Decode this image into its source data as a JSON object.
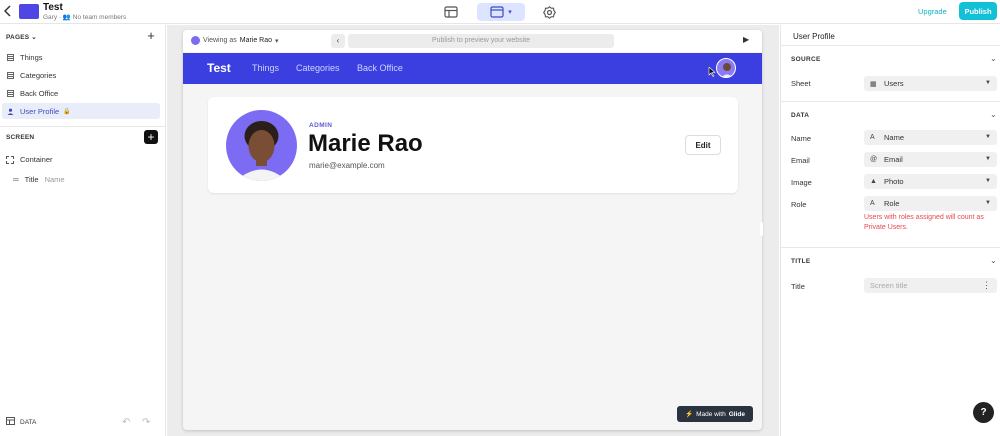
{
  "topbar": {
    "app_title": "Test",
    "app_subtitle_user": "Gary",
    "app_subtitle_team": "No team members",
    "upgrade_label": "Upgrade",
    "publish_label": "Publish"
  },
  "left": {
    "pages_heading": "PAGES",
    "pages": [
      {
        "label": "Things",
        "icon": "table-icon"
      },
      {
        "label": "Categories",
        "icon": "table-icon"
      },
      {
        "label": "Back Office",
        "icon": "table-icon"
      },
      {
        "label": "User Profile",
        "icon": "user-icon",
        "active": true,
        "locked": true
      }
    ],
    "screen_heading": "SCREEN",
    "screen_items": [
      {
        "label": "Container",
        "icon": "container-icon"
      },
      {
        "label": "Title",
        "sub": "Name",
        "icon": "title-icon"
      }
    ],
    "data_label": "DATA"
  },
  "canvas": {
    "viewing_prefix": "Viewing as",
    "viewing_user": "Marie Rao",
    "url_placeholder": "Publish to preview your website",
    "app_brand": "Test",
    "nav_links": [
      "Things",
      "Categories",
      "Back Office"
    ],
    "profile": {
      "role": "ADMIN",
      "name": "Marie Rao",
      "email": "marie@example.com",
      "edit_label": "Edit"
    },
    "made_with_prefix": "Made with",
    "made_with_brand": "Glide",
    "accent_color": "#3b3fe0"
  },
  "right": {
    "title": "User Profile",
    "source_heading": "SOURCE",
    "sheet_label": "Sheet",
    "sheet_value": "Users",
    "data_heading": "DATA",
    "fields": [
      {
        "label": "Name",
        "value": "Name",
        "icon": "text-icon"
      },
      {
        "label": "Email",
        "value": "Email",
        "icon": "at-icon"
      },
      {
        "label": "Image",
        "value": "Photo",
        "icon": "image-icon"
      },
      {
        "label": "Role",
        "value": "Role",
        "icon": "text-icon"
      }
    ],
    "role_note": "Users with roles assigned will count as Private Users.",
    "title_heading": "TITLE",
    "title_label": "Title",
    "title_placeholder": "Screen title"
  },
  "help_label": "?"
}
